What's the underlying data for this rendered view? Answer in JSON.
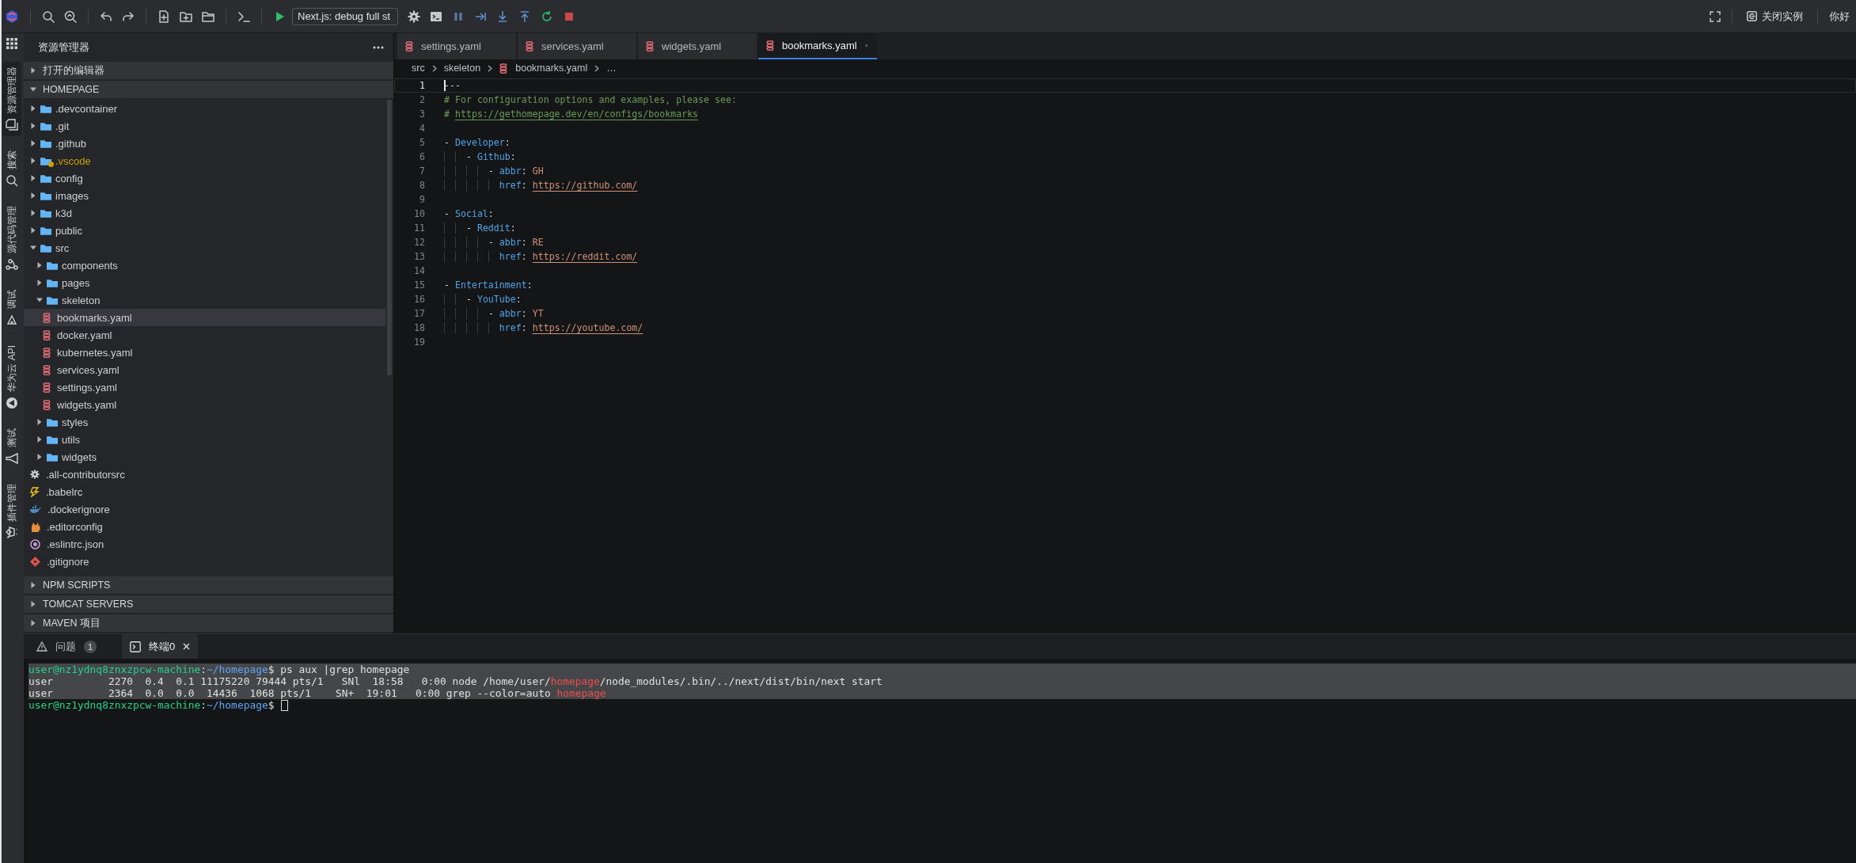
{
  "toolbar": {
    "debug_config": "Next.js: debug full st",
    "close_instance": "关闭实例",
    "greeting": "你好"
  },
  "activity_bar": [
    {
      "kind": "explorer",
      "label": "资源管理器",
      "selected": true
    },
    {
      "kind": "search",
      "label": "搜索",
      "selected": false
    },
    {
      "kind": "source-control",
      "label": "源代码管理",
      "selected": false
    },
    {
      "kind": "debug",
      "label": "调试",
      "selected": false
    },
    {
      "kind": "cloud-api",
      "label": "华为云 API",
      "selected": false
    },
    {
      "kind": "test",
      "label": "测试",
      "selected": false
    },
    {
      "kind": "extensions",
      "label": "插件管理",
      "selected": false
    }
  ],
  "sidebar": {
    "title": "资源管理器",
    "sections": [
      {
        "label": "打开的编辑器",
        "expanded": false
      },
      {
        "label": "HOMEPAGE",
        "expanded": true,
        "tree": [
          {
            "label": ".devcontainer",
            "kind": "folder",
            "expanded": false,
            "selected": false,
            "warning": false
          },
          {
            "label": ".git",
            "kind": "folder",
            "expanded": false,
            "selected": false,
            "warning": false
          },
          {
            "label": ".github",
            "kind": "folder",
            "expanded": false,
            "selected": false,
            "warning": false
          },
          {
            "label": ".vscode",
            "kind": "folder",
            "expanded": false,
            "selected": false,
            "warning": true
          },
          {
            "label": "config",
            "kind": "folder",
            "expanded": false,
            "selected": false,
            "warning": false
          },
          {
            "label": "images",
            "kind": "folder",
            "expanded": false,
            "selected": false,
            "warning": false
          },
          {
            "label": "k3d",
            "kind": "folder",
            "expanded": false,
            "selected": false,
            "warning": false
          },
          {
            "label": "public",
            "kind": "folder",
            "expanded": false,
            "selected": false,
            "warning": false
          },
          {
            "label": "src",
            "kind": "folder",
            "expanded": true,
            "selected": false,
            "warning": false,
            "children": [
              {
                "label": "components",
                "kind": "folder",
                "expanded": false,
                "selected": false,
                "warning": false
              },
              {
                "label": "pages",
                "kind": "folder",
                "expanded": false,
                "selected": false,
                "warning": false
              },
              {
                "label": "skeleton",
                "kind": "folder",
                "expanded": true,
                "selected": false,
                "warning": false,
                "children": [
                  {
                    "label": "bookmarks.yaml",
                    "kind": "yaml",
                    "selected": true,
                    "warning": false
                  },
                  {
                    "label": "docker.yaml",
                    "kind": "yaml",
                    "selected": false,
                    "warning": false
                  },
                  {
                    "label": "kubernetes.yaml",
                    "kind": "yaml",
                    "selected": false,
                    "warning": false
                  },
                  {
                    "label": "services.yaml",
                    "kind": "yaml",
                    "selected": false,
                    "warning": false
                  },
                  {
                    "label": "settings.yaml",
                    "kind": "yaml",
                    "selected": false,
                    "warning": false
                  },
                  {
                    "label": "widgets.yaml",
                    "kind": "yaml",
                    "selected": false,
                    "warning": false
                  }
                ]
              },
              {
                "label": "styles",
                "kind": "folder",
                "expanded": false,
                "selected": false,
                "warning": false
              },
              {
                "label": "utils",
                "kind": "folder",
                "expanded": false,
                "selected": false,
                "warning": false
              },
              {
                "label": "widgets",
                "kind": "folder",
                "expanded": false,
                "selected": false,
                "warning": false
              }
            ]
          },
          {
            "label": ".all-contributorsrc",
            "kind": "config",
            "selected": false,
            "warning": false
          },
          {
            "label": ".babelrc",
            "kind": "babel",
            "selected": false,
            "warning": false
          },
          {
            "label": ".dockerignore",
            "kind": "docker",
            "selected": false,
            "warning": false
          },
          {
            "label": ".editorconfig",
            "kind": "editorconfig",
            "selected": false,
            "warning": false
          },
          {
            "label": ".eslintrc.json",
            "kind": "eslint",
            "selected": false,
            "warning": false
          },
          {
            "label": ".gitignore",
            "kind": "git",
            "selected": false,
            "warning": false
          }
        ]
      },
      {
        "label": "NPM SCRIPTS",
        "expanded": false
      },
      {
        "label": "TOMCAT SERVERS",
        "expanded": false
      },
      {
        "label": "MAVEN 项目",
        "expanded": false
      }
    ]
  },
  "editor": {
    "tabs": [
      {
        "label": "settings.yaml",
        "kind": "yaml",
        "selected": false
      },
      {
        "label": "services.yaml",
        "kind": "yaml",
        "selected": false
      },
      {
        "label": "widgets.yaml",
        "kind": "yaml",
        "selected": false
      },
      {
        "label": "bookmarks.yaml",
        "kind": "yaml",
        "selected": true
      }
    ],
    "breadcrumb": [
      {
        "label": "src",
        "kind": "folder"
      },
      {
        "label": "skeleton",
        "kind": "folder"
      },
      {
        "label": "bookmarks.yaml",
        "kind": "yaml"
      },
      {
        "label": "…",
        "kind": "more"
      }
    ],
    "lines": [
      {
        "n": "1",
        "current": true,
        "tokens": [
          {
            "kind": "punct",
            "text": "---"
          }
        ]
      },
      {
        "n": "2",
        "current": false,
        "tokens": [
          {
            "kind": "comment",
            "text": "# For configuration options and examples, please see:"
          }
        ]
      },
      {
        "n": "3",
        "current": false,
        "tokens": [
          {
            "kind": "comment",
            "text": "# "
          },
          {
            "kind": "comment-link",
            "text": "https://gethomepage.dev/en/configs/bookmarks"
          }
        ]
      },
      {
        "n": "4",
        "current": false
      },
      {
        "n": "5",
        "current": false,
        "tokens": [
          {
            "kind": "punct",
            "text": "- "
          },
          {
            "kind": "key",
            "text": "Developer"
          },
          {
            "kind": "punct",
            "text": ":"
          }
        ]
      },
      {
        "n": "6",
        "current": false,
        "tokens": [
          {
            "kind": "punct",
            "text": "    - "
          },
          {
            "kind": "key",
            "text": "Github"
          },
          {
            "kind": "punct",
            "text": ":"
          }
        ]
      },
      {
        "n": "7",
        "current": false,
        "tokens": [
          {
            "kind": "punct",
            "text": "        - "
          },
          {
            "kind": "key",
            "text": "abbr"
          },
          {
            "kind": "punct",
            "text": ": "
          },
          {
            "kind": "value",
            "text": "GH"
          }
        ]
      },
      {
        "n": "8",
        "current": false,
        "tokens": [
          {
            "kind": "key",
            "text": "          href"
          },
          {
            "kind": "punct",
            "text": ": "
          },
          {
            "kind": "link",
            "text": "https://github.com/"
          }
        ]
      },
      {
        "n": "9",
        "current": false
      },
      {
        "n": "10",
        "current": false,
        "tokens": [
          {
            "kind": "punct",
            "text": "- "
          },
          {
            "kind": "key",
            "text": "Social"
          },
          {
            "kind": "punct",
            "text": ":"
          }
        ]
      },
      {
        "n": "11",
        "current": false,
        "tokens": [
          {
            "kind": "punct",
            "text": "    - "
          },
          {
            "kind": "key",
            "text": "Reddit"
          },
          {
            "kind": "punct",
            "text": ":"
          }
        ]
      },
      {
        "n": "12",
        "current": false,
        "tokens": [
          {
            "kind": "punct",
            "text": "        - "
          },
          {
            "kind": "key",
            "text": "abbr"
          },
          {
            "kind": "punct",
            "text": ": "
          },
          {
            "kind": "value",
            "text": "RE"
          }
        ]
      },
      {
        "n": "13",
        "current": false,
        "tokens": [
          {
            "kind": "key",
            "text": "          href"
          },
          {
            "kind": "punct",
            "text": ": "
          },
          {
            "kind": "link",
            "text": "https://reddit.com/"
          }
        ]
      },
      {
        "n": "14",
        "current": false
      },
      {
        "n": "15",
        "current": false,
        "tokens": [
          {
            "kind": "punct",
            "text": "- "
          },
          {
            "kind": "key",
            "text": "Entertainment"
          },
          {
            "kind": "punct",
            "text": ":"
          }
        ]
      },
      {
        "n": "16",
        "current": false,
        "tokens": [
          {
            "kind": "punct",
            "text": "    - "
          },
          {
            "kind": "key",
            "text": "YouTube"
          },
          {
            "kind": "punct",
            "text": ":"
          }
        ]
      },
      {
        "n": "17",
        "current": false,
        "tokens": [
          {
            "kind": "punct",
            "text": "        - "
          },
          {
            "kind": "key",
            "text": "abbr"
          },
          {
            "kind": "punct",
            "text": ": "
          },
          {
            "kind": "value",
            "text": "YT"
          }
        ]
      },
      {
        "n": "18",
        "current": false,
        "tokens": [
          {
            "kind": "key",
            "text": "          href"
          },
          {
            "kind": "punct",
            "text": ": "
          },
          {
            "kind": "link",
            "text": "https://youtube.com/"
          }
        ]
      },
      {
        "n": "19",
        "current": false
      }
    ]
  },
  "panel": {
    "tabs": [
      {
        "kind": "problems",
        "label": "问题",
        "badge": "1",
        "selected": false,
        "closable": false
      },
      {
        "kind": "terminal",
        "label": "终端0",
        "selected": true,
        "closable": true
      }
    ],
    "terminal": [
      {
        "selected": true,
        "cursor": false,
        "segments": [
          {
            "kind": "user",
            "text": "user@nz1ydnq8znxzpcw-machine"
          },
          {
            "kind": "plain",
            "text": ":"
          },
          {
            "kind": "path",
            "text": "~/homepage"
          },
          {
            "kind": "plain",
            "text": "$ ps aux |grep homepage"
          }
        ]
      },
      {
        "selected": true,
        "cursor": false,
        "segments": [
          {
            "kind": "plain",
            "text": "user         2270  0.4  0.1 11175220 79444 pts/1   SNl  18:58   0:00 node /home/user/"
          },
          {
            "kind": "match",
            "text": "homepage"
          },
          {
            "kind": "plain",
            "text": "/node_modules/.bin/../next/dist/bin/next start"
          }
        ]
      },
      {
        "selected": true,
        "cursor": false,
        "segments": [
          {
            "kind": "plain",
            "text": "user         2364  0.0  0.0  14436  1068 pts/1    SN+  19:01   0:00 grep --color=auto "
          },
          {
            "kind": "match",
            "text": "homepage"
          }
        ]
      },
      {
        "selected": false,
        "cursor": true,
        "segments": [
          {
            "kind": "user",
            "text": "user@nz1ydnq8znxzpcw-machine"
          },
          {
            "kind": "plain",
            "text": ":"
          },
          {
            "kind": "path",
            "text": "~/homepage"
          },
          {
            "kind": "plain",
            "text": "$ "
          }
        ]
      }
    ]
  }
}
